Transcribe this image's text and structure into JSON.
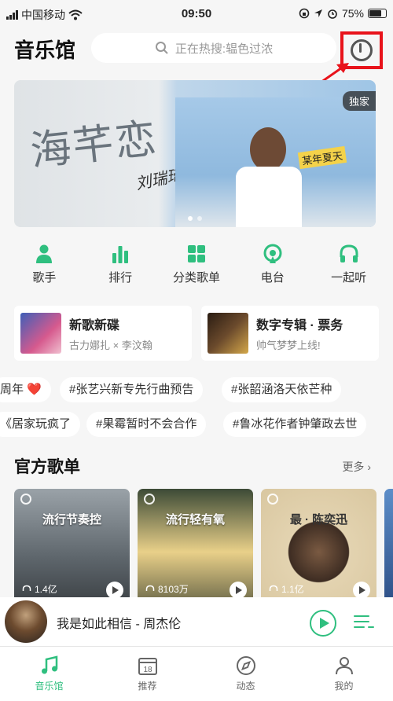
{
  "status": {
    "carrier": "中国移动",
    "time": "09:50",
    "battery": "75%"
  },
  "header": {
    "title": "音乐馆",
    "search_placeholder": "正在热搜:辒色过浓"
  },
  "banner": {
    "art_text": "海芊恋",
    "artist_sign": "刘瑞琦",
    "badge": "独家",
    "tag": "某年夏天"
  },
  "categories": [
    {
      "label": "歌手",
      "icon": "singer-icon"
    },
    {
      "label": "排行",
      "icon": "chart-icon"
    },
    {
      "label": "分类歌单",
      "icon": "grid-icon"
    },
    {
      "label": "电台",
      "icon": "radio-icon"
    },
    {
      "label": "一起听",
      "icon": "headphones-icon"
    }
  ],
  "cards": [
    {
      "title": "新歌新碟",
      "subtitle": "古力娜扎 × 李汶翰"
    },
    {
      "title": "数字专辑 · 票务",
      "subtitle": "帅气梦梦上线!"
    }
  ],
  "chips_row1": [
    "周年 ❤️",
    "#张艺兴新专先行曲预告",
    "#张韶涵洛天依芒种"
  ],
  "chips_row2": [
    "《居家玩疯了",
    "#果霉暂时不会合作",
    "#鲁冰花作者钟肇政去世"
  ],
  "playlists": {
    "section_title": "官方歌单",
    "more": "更多 ›",
    "items": [
      {
        "name": "流行节奏控",
        "count": "1.4亿"
      },
      {
        "name": "流行轻有氧",
        "count": "8103万"
      },
      {
        "name": "最 · 陈奕迅",
        "count": "1.1亿"
      }
    ]
  },
  "player": {
    "song": "我是如此相信 - 周杰伦"
  },
  "tabs": [
    {
      "label": "音乐馆",
      "active": true
    },
    {
      "label": "推荐",
      "badge": "18"
    },
    {
      "label": "动态"
    },
    {
      "label": "我的"
    }
  ],
  "colors": {
    "accent": "#2fbf7f",
    "highlight_box": "#e8131b"
  }
}
